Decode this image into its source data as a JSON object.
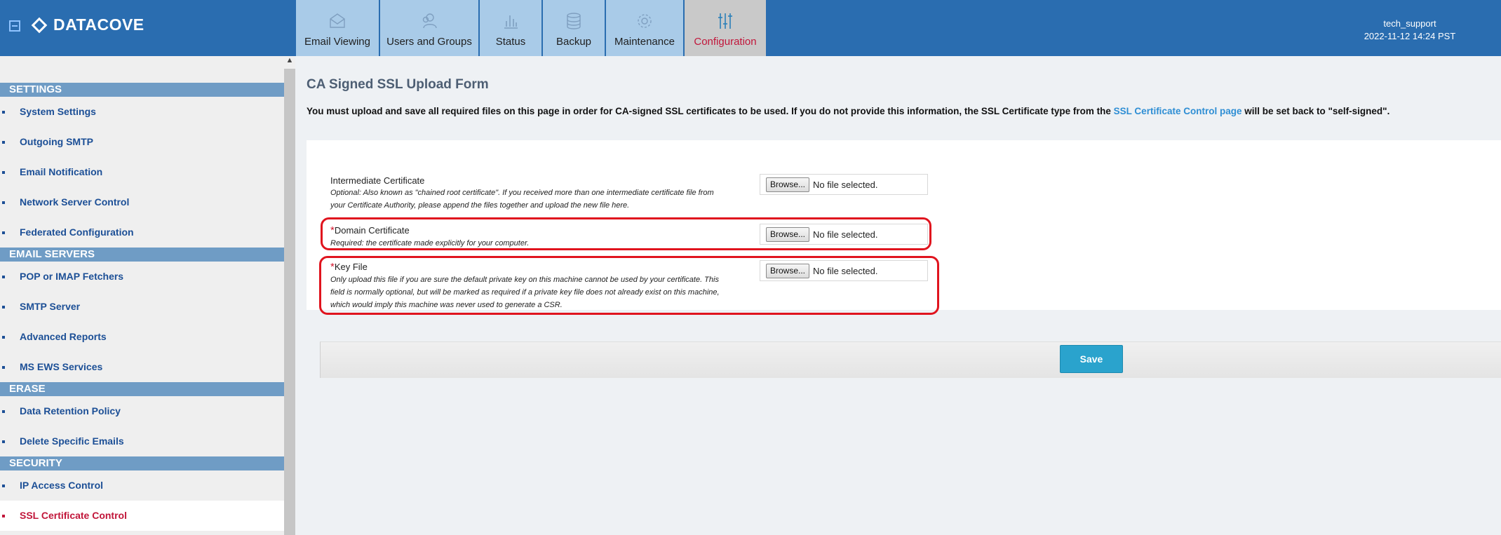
{
  "app": {
    "logo_text": "DATACOVE"
  },
  "nav_tabs": [
    {
      "label": "Email Viewing",
      "icon": "envelope-icon"
    },
    {
      "label": "Users and Groups",
      "icon": "users-icon"
    },
    {
      "label": "Status",
      "icon": "bar-chart-icon"
    },
    {
      "label": "Backup",
      "icon": "database-icon"
    },
    {
      "label": "Maintenance",
      "icon": "gear-icon"
    },
    {
      "label": "Configuration",
      "icon": "sliders-icon",
      "active": true
    }
  ],
  "user": {
    "name": "tech_support",
    "datetime": "2022-11-12 14:24 PST"
  },
  "sidebar": {
    "sections": [
      {
        "header": "SETTINGS",
        "items": [
          "System Settings",
          "Outgoing SMTP",
          "Email Notification",
          "Network Server Control",
          "Federated Configuration"
        ]
      },
      {
        "header": "EMAIL SERVERS",
        "items": [
          "POP or IMAP Fetchers",
          "SMTP Server",
          "Advanced Reports",
          "MS EWS Services"
        ]
      },
      {
        "header": "ERASE",
        "items": [
          "Data Retention Policy",
          "Delete Specific Emails"
        ]
      },
      {
        "header": "SECURITY",
        "items": [
          "IP Access Control",
          "SSL Certificate Control"
        ]
      }
    ],
    "active_item": "SSL Certificate Control"
  },
  "page": {
    "title": "CA Signed SSL Upload Form",
    "intro_before_link": "You must upload and save all required files on this page in order for CA-signed SSL certificates to be used. If you do not provide this information, the SSL Certificate type from the ",
    "intro_link": "SSL Certificate Control page",
    "intro_after_link": " will be set back to \"self-signed\"."
  },
  "form": {
    "fields": [
      {
        "label": "Intermediate Certificate",
        "required": false,
        "help_lines": [
          "Optional: Also known as \"chained root certificate\". If you received more than one intermediate certificate file from",
          "your Certificate Authority, please append the files together and upload the new file here."
        ],
        "browse_label": "Browse...",
        "file_status": "No file selected."
      },
      {
        "label": "Domain Certificate",
        "required": true,
        "help_lines": [
          "Required: the certificate made explicitly for your computer."
        ],
        "browse_label": "Browse...",
        "file_status": "No file selected."
      },
      {
        "label": "Key File",
        "required": true,
        "help_lines": [
          "Only upload this file if you are sure the default private key on this machine cannot be used by your certificate. This",
          "field is normally optional, but will be marked as required if a private key file does not already exist on this machine,",
          "which would imply this machine was never used to generate a CSR."
        ],
        "browse_label": "Browse...",
        "file_status": "No file selected."
      }
    ],
    "required_marker": "*",
    "save_label": "Save"
  },
  "colors": {
    "topbar": "#2a6db0",
    "accent_red": "#c1163a",
    "link": "#2e8ed4",
    "save_button": "#2aa3cd",
    "highlight": "#e0141e"
  }
}
